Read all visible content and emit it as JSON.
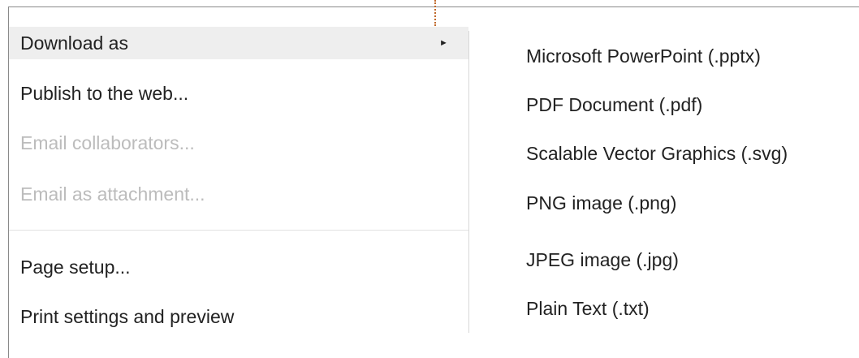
{
  "menu": {
    "items": [
      {
        "label": "Download as",
        "has_submenu": true,
        "highlighted": true,
        "disabled": false
      },
      {
        "label": "Publish to the web...",
        "has_submenu": false,
        "highlighted": false,
        "disabled": false
      },
      {
        "label": "Email collaborators...",
        "has_submenu": false,
        "highlighted": false,
        "disabled": true
      },
      {
        "label": "Email as attachment...",
        "has_submenu": false,
        "highlighted": false,
        "disabled": true
      },
      {
        "label": "Page setup...",
        "has_submenu": false,
        "highlighted": false,
        "disabled": false
      },
      {
        "label": "Print settings and preview",
        "has_submenu": false,
        "highlighted": false,
        "disabled": false
      }
    ],
    "submenu_arrow": "►"
  },
  "submenu": {
    "items": [
      {
        "label": "Microsoft PowerPoint (.pptx)"
      },
      {
        "label": "PDF Document (.pdf)"
      },
      {
        "label": "Scalable Vector Graphics (.svg)"
      },
      {
        "label": "PNG image (.png)"
      },
      {
        "label": "JPEG image (.jpg)"
      },
      {
        "label": "Plain Text (.txt)"
      }
    ]
  },
  "colors": {
    "text": "#222222",
    "disabled_text": "#bcbcbc",
    "highlight_bg": "#eeeeee",
    "guide": "#c0692b"
  }
}
